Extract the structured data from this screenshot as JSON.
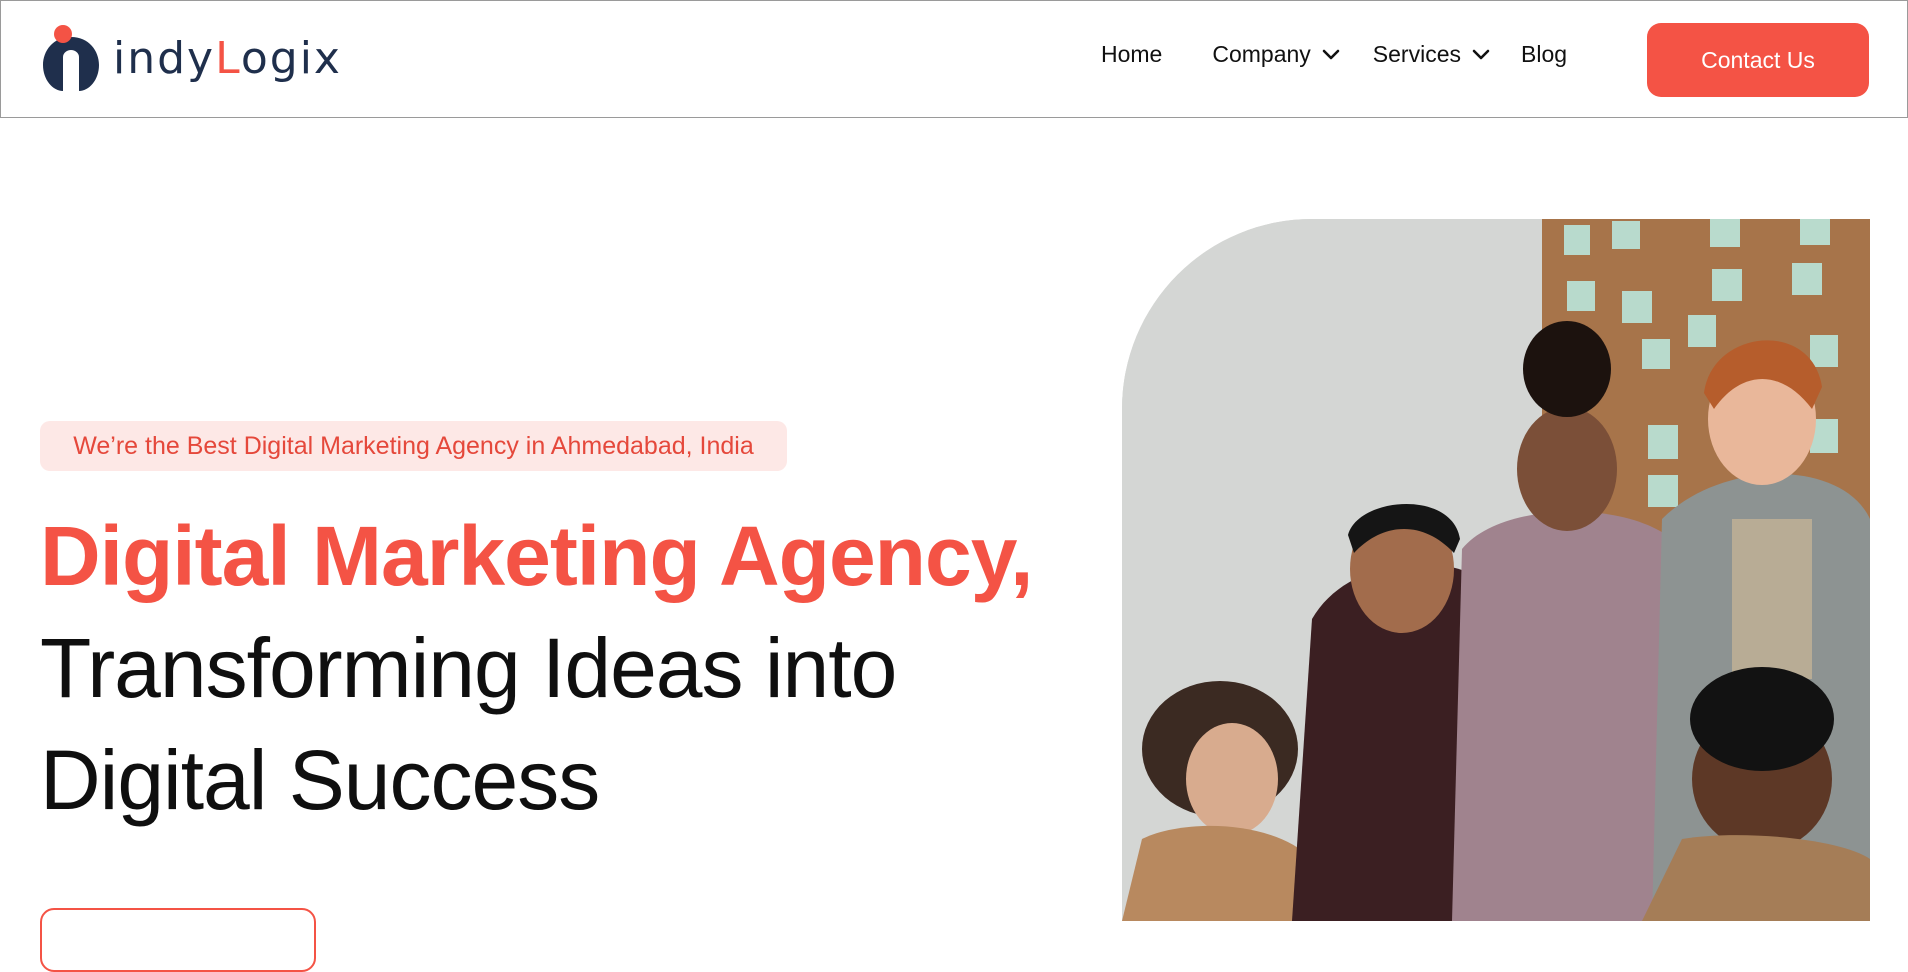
{
  "header": {
    "logo": {
      "text_pre": "indy",
      "text_accent": "L",
      "text_post": "ogix"
    },
    "nav": {
      "home": "Home",
      "company": "Company",
      "services": "Services",
      "blog": "Blog"
    },
    "contact_label": "Contact Us"
  },
  "hero": {
    "badge": "We’re the Best Digital Marketing Agency in Ahmedabad, India",
    "headline_accent": "Digital Marketing Agency,",
    "headline_rest": "Transforming Ideas into Digital Success"
  },
  "colors": {
    "accent": "#f45345",
    "navy": "#1f2f4c",
    "badge_bg": "#fde8e6"
  },
  "icons": {
    "company_dropdown": "chevron-down-icon",
    "services_dropdown": "chevron-down-icon"
  }
}
